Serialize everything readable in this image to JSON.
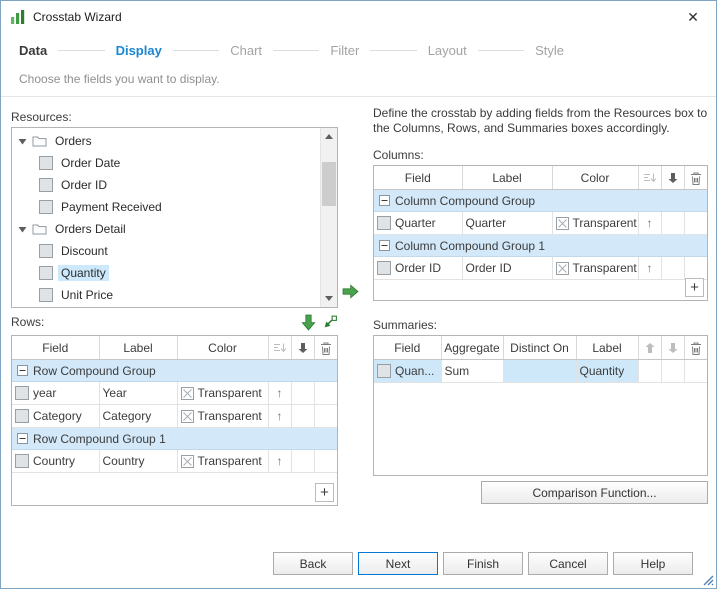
{
  "window": {
    "title": "Crosstab Wizard",
    "close_glyph": "✕"
  },
  "steps": {
    "items": [
      "Data",
      "Display",
      "Chart",
      "Filter",
      "Layout",
      "Style"
    ],
    "active_step": "Display",
    "completed_step": "Data"
  },
  "subtitle": "Choose the fields you want to display.",
  "left": {
    "resources_label": "Resources:",
    "tree": [
      {
        "label": "Orders",
        "type": "folder"
      },
      {
        "label": "Order Date",
        "type": "field"
      },
      {
        "label": "Order ID",
        "type": "field"
      },
      {
        "label": "Payment Received",
        "type": "field"
      },
      {
        "label": "Orders Detail",
        "type": "folder"
      },
      {
        "label": "Discount",
        "type": "field"
      },
      {
        "label": "Quantity",
        "type": "field",
        "selected": true
      },
      {
        "label": "Unit Price",
        "type": "field"
      }
    ],
    "rows_label": "Rows:",
    "rows_headers": [
      "Field",
      "Label",
      "Color"
    ],
    "rows": [
      {
        "type": "group",
        "title": "Row Compound Group"
      },
      {
        "type": "field",
        "field": "year",
        "label": "Year",
        "color": "Transparent"
      },
      {
        "type": "field",
        "field": "Category",
        "label": "Category",
        "color": "Transparent"
      },
      {
        "type": "group",
        "title": "Row Compound Group 1"
      },
      {
        "type": "field",
        "field": "Country",
        "label": "Country",
        "color": "Transparent"
      }
    ]
  },
  "right": {
    "instructions": "Define the crosstab by adding fields from the Resources box to the Columns, Rows, and Summaries boxes accordingly.",
    "columns_label": "Columns:",
    "columns_headers": [
      "Field",
      "Label",
      "Color"
    ],
    "columns": [
      {
        "type": "group",
        "title": "Column Compound Group"
      },
      {
        "type": "field",
        "field": "Quarter",
        "label": "Quarter",
        "color": "Transparent"
      },
      {
        "type": "group",
        "title": "Column Compound Group 1"
      },
      {
        "type": "field",
        "field": "Order ID",
        "label": "Order ID",
        "color": "Transparent"
      }
    ],
    "summaries_label": "Summaries:",
    "summaries_headers": [
      "Field",
      "Aggregate",
      "Distinct On",
      "Label"
    ],
    "summaries": [
      {
        "field": "Quan...",
        "aggregate": "Sum",
        "distinct_on": "",
        "label": "Quantity"
      }
    ],
    "comparison_button": "Comparison Function..."
  },
  "footer": {
    "buttons": [
      "Back",
      "Next",
      "Finish",
      "Cancel",
      "Help"
    ],
    "default_button": "Next"
  },
  "colors": {
    "accent_blue": "#1b86d2",
    "group_row_bg": "#d3e8f8",
    "selection_bg": "#cde9fb",
    "move_green": "#4aa24e"
  }
}
